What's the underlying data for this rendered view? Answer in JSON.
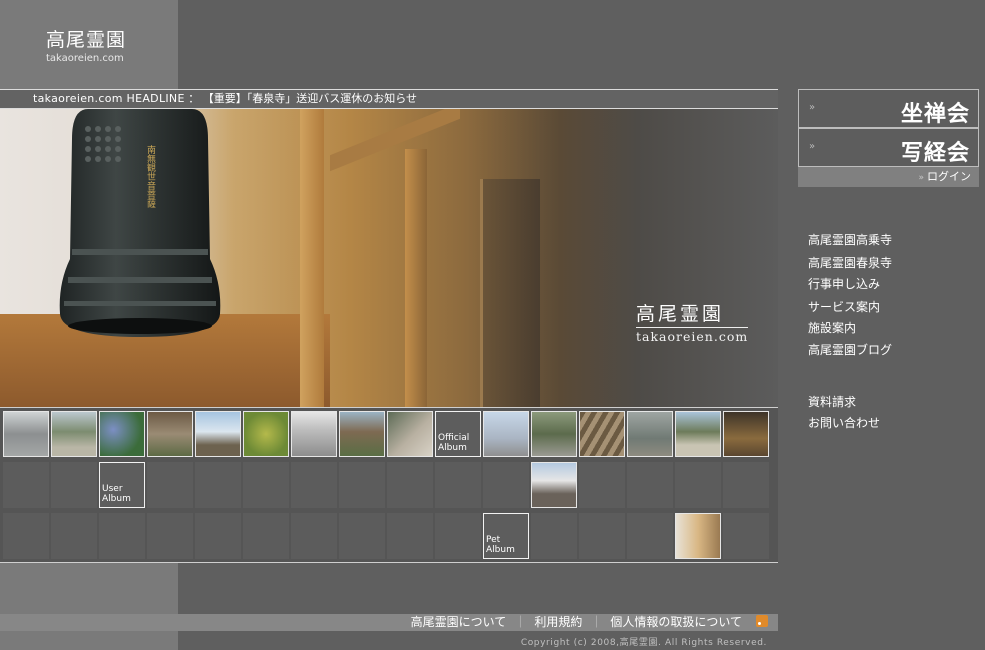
{
  "logo": {
    "jp": "高尾霊園",
    "en": "takaoreien.com"
  },
  "headline": {
    "label": "takaoreien.com HEADLINE",
    "separator": "：",
    "text": "【重要】「春泉寺」送迎バス運休のお知らせ"
  },
  "hero": {
    "title_jp": "高尾霊園",
    "title_en": "takaoreien.com",
    "bell_inscription": "南無観世音菩薩"
  },
  "albums": {
    "official": [
      "Official",
      "Album"
    ],
    "user": [
      "User",
      "Album"
    ],
    "pet": [
      "Pet",
      "Album"
    ]
  },
  "sidebar": {
    "boxes": [
      {
        "arrow": "»",
        "label": "坐禅会"
      },
      {
        "arrow": "»",
        "label": "写経会"
      }
    ],
    "login": {
      "arrow": "»",
      "label": "ログイン"
    },
    "nav": [
      "高尾霊園高乗寺",
      "高尾霊園春泉寺",
      "行事申し込み",
      "サービス案内",
      "施設案内",
      "高尾霊園ブログ"
    ],
    "nav2": [
      "資料請求",
      "お問い合わせ"
    ]
  },
  "footer": {
    "links": [
      "高尾霊園について",
      "利用規約",
      "個人情報の取扱について"
    ],
    "separator": "｜",
    "copyright": "Copyright (c) 2008,高尾霊園. All Rights Reserved."
  },
  "colors": {
    "background": "#5f5f5f",
    "left_stripe": "#7a7a7a",
    "rss": "#e08a2a"
  }
}
